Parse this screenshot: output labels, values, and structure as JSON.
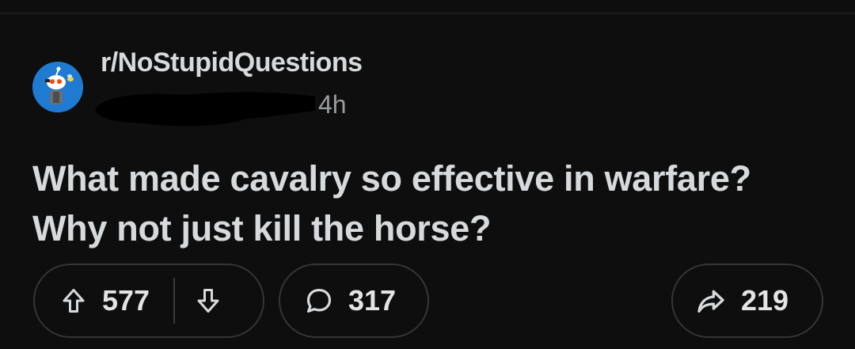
{
  "post": {
    "subreddit": "r/NoStupidQuestions",
    "time": "4h",
    "title": "What made cavalry so effective in warfare? Why not just kill the horse?"
  },
  "actions": {
    "upvotes": "577",
    "comments": "317",
    "shares": "219"
  },
  "icons": {
    "avatar": "snoo-avatar-icon",
    "upvote": "arrow-up-icon",
    "downvote": "arrow-down-icon",
    "comment": "comment-bubble-icon",
    "share": "share-arrow-icon"
  },
  "colors": {
    "background": "#0e0e0e",
    "text": "#d7dadc",
    "muted": "#9a9da0",
    "avatar_bg": "#1f7bd1",
    "pill_border": "#343536"
  }
}
